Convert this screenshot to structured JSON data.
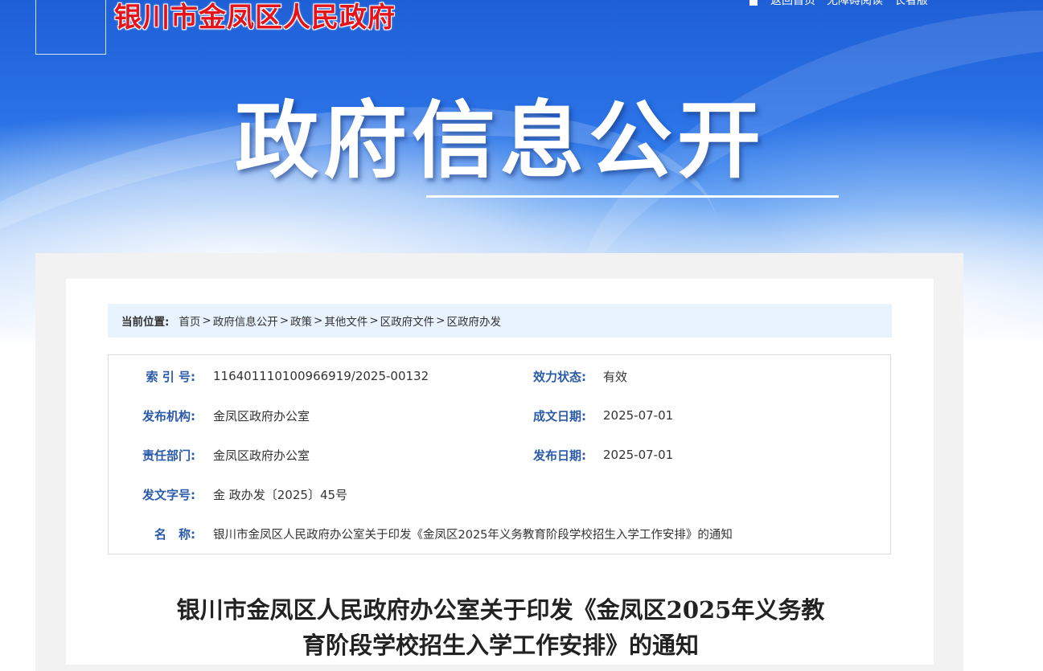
{
  "header": {
    "site_title": "银川市金凤区人民政府",
    "top_links": [
      "返回首页",
      "无障碍阅读",
      "长者版"
    ]
  },
  "banner": {
    "title": "政府信息公开"
  },
  "breadcrumb": {
    "label": "当前位置:",
    "items": [
      "首页",
      "政府信息公开",
      "政策",
      "其他文件",
      "区政府文件",
      "区政府办发"
    ],
    "separator": ">"
  },
  "meta": {
    "index_label": "索 引 号:",
    "index_value": "116401110100966919/2025-00132",
    "status_label": "效力状态:",
    "status_value": "有效",
    "publisher_label": "发布机构:",
    "publisher_value": "金凤区政府办公室",
    "created_label": "成文日期:",
    "created_value": "2025-07-01",
    "dept_label": "责任部门:",
    "dept_value": "金凤区政府办公室",
    "published_label": "发布日期:",
    "published_value": "2025-07-01",
    "docno_label": "发文字号:",
    "docno_value": "金 政办发〔2025〕45号",
    "name_label": "名　称:",
    "name_value": "银川市金凤区人民政府办公室关于印发《金凤区2025年义务教育阶段学校招生入学工作安排》的通知"
  },
  "document": {
    "title_line1": "银川市金凤区人民政府办公室关于印发《金凤区2025年义务教",
    "title_line2": "育阶段学校招生入学工作安排》的通知"
  }
}
